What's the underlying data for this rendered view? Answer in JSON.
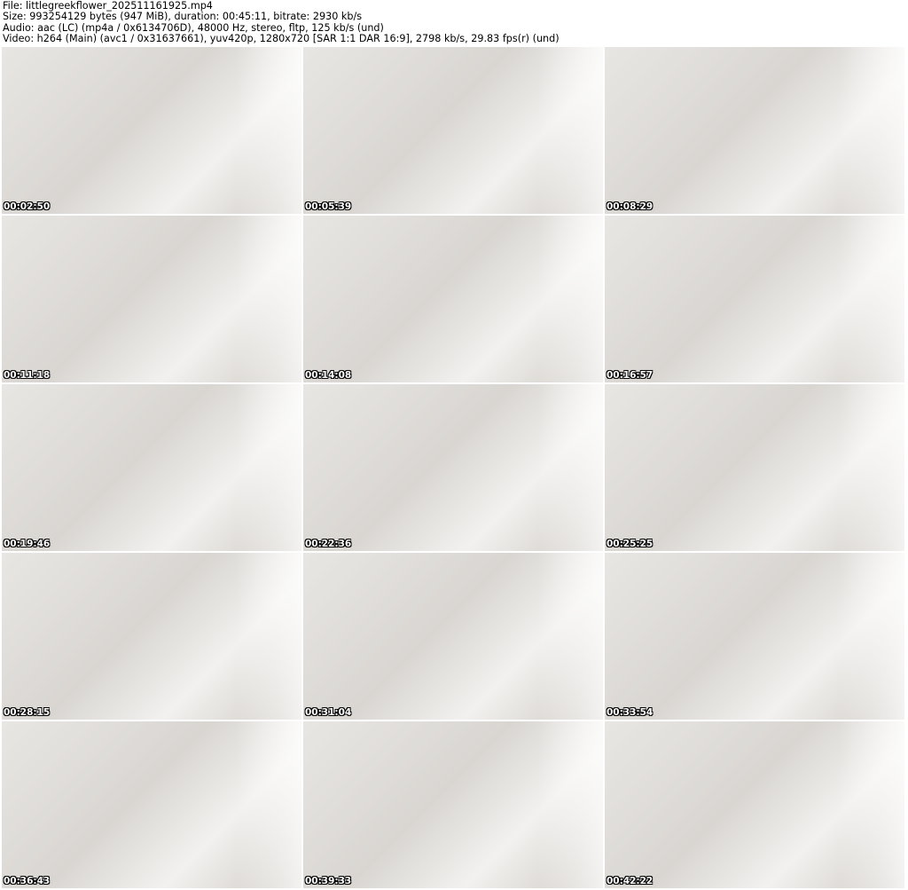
{
  "header": {
    "file": "File: littlegreekflower_202511161925.mp4",
    "size": "Size: 993254129 bytes (947 MiB), duration: 00:45:11, bitrate: 2930 kb/s",
    "audio": "Audio: aac (LC) (mp4a / 0x6134706D), 48000 Hz, stereo, fltp, 125 kb/s (und)",
    "video": "Video: h264 (Main) (avc1 / 0x31637661), yuv420p, 1280x720 [SAR 1:1 DAR 16:9], 2798 kb/s, 29.83 fps(r) (und)"
  },
  "thumbnails": [
    {
      "timestamp": "00:02:50"
    },
    {
      "timestamp": "00:05:39"
    },
    {
      "timestamp": "00:08:29"
    },
    {
      "timestamp": "00:11:18"
    },
    {
      "timestamp": "00:14:08"
    },
    {
      "timestamp": "00:16:57"
    },
    {
      "timestamp": "00:19:46"
    },
    {
      "timestamp": "00:22:36"
    },
    {
      "timestamp": "00:25:25"
    },
    {
      "timestamp": "00:28:15"
    },
    {
      "timestamp": "00:31:04"
    },
    {
      "timestamp": "00:33:54"
    },
    {
      "timestamp": "00:36:43"
    },
    {
      "timestamp": "00:39:33"
    },
    {
      "timestamp": "00:42:22"
    }
  ]
}
